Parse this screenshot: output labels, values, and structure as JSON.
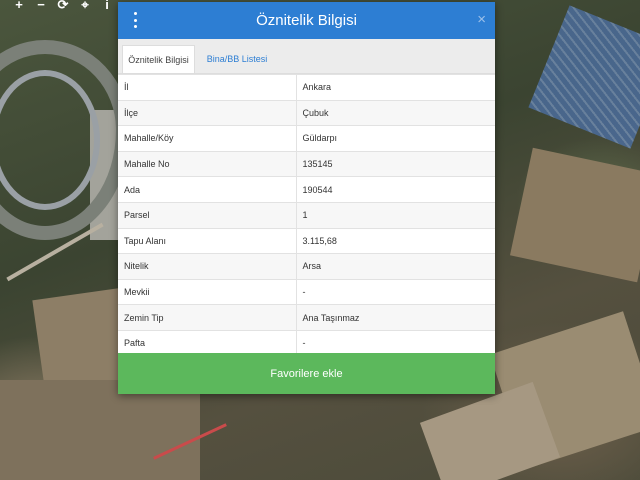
{
  "map_toolbar": {
    "zoom_in": "+",
    "zoom_out": "−",
    "refresh": "⟳",
    "locate": "⌖",
    "info": "i"
  },
  "modal": {
    "title": "Öznitelik Bilgisi",
    "close": "×",
    "tabs": [
      {
        "label": "Öznitelik Bilgisi",
        "active": true
      },
      {
        "label": "Bina/BB Listesi",
        "active": false
      }
    ],
    "rows": [
      {
        "key": "İl",
        "value": "Ankara"
      },
      {
        "key": "İlçe",
        "value": "Çubuk"
      },
      {
        "key": "Mahalle/Köy",
        "value": "Güldarpı"
      },
      {
        "key": "Mahalle No",
        "value": "135145"
      },
      {
        "key": "Ada",
        "value": "190544"
      },
      {
        "key": "Parsel",
        "value": "1"
      },
      {
        "key": "Tapu Alanı",
        "value": "3.115,68"
      },
      {
        "key": "Nitelik",
        "value": "Arsa"
      },
      {
        "key": "Mevkii",
        "value": "-"
      },
      {
        "key": "Zemin Tip",
        "value": "Ana Taşınmaz"
      },
      {
        "key": "Pafta",
        "value": "-"
      }
    ],
    "favorite_button": "Favorilere ekle"
  },
  "colors": {
    "header": "#2d7ed3",
    "tab_link": "#2d7ed3",
    "favorite_button": "#5cb85c"
  },
  "icons": [
    "plus-icon",
    "minus-icon",
    "refresh-icon",
    "locate-icon",
    "info-icon",
    "kebab-menu-icon",
    "close-icon"
  ]
}
